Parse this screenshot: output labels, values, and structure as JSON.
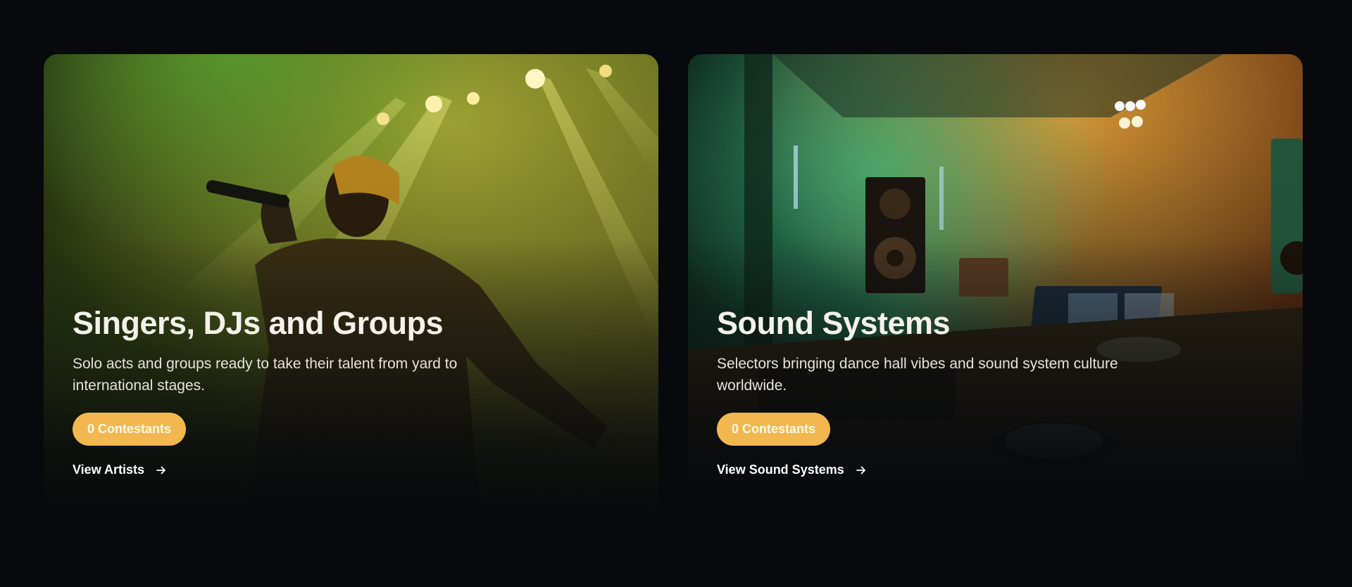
{
  "cards": [
    {
      "title": "Singers, DJs and Groups",
      "description": "Solo acts and groups ready to take their talent from yard to international stages.",
      "badge": "0 Contestants",
      "link": "View Artists",
      "link_icon": "arrow-right-icon",
      "image": "singer-on-stage-photo"
    },
    {
      "title": "Sound Systems",
      "description": "Selectors bringing dance hall vibes and sound system culture worldwide.",
      "badge": "0 Contestants",
      "link": "View Sound Systems",
      "link_icon": "arrow-right-icon",
      "image": "sound-system-studio-photo"
    }
  ],
  "colors": {
    "background": "#07090c",
    "badge": "#f2b84f",
    "text": "#f3f1ea"
  }
}
